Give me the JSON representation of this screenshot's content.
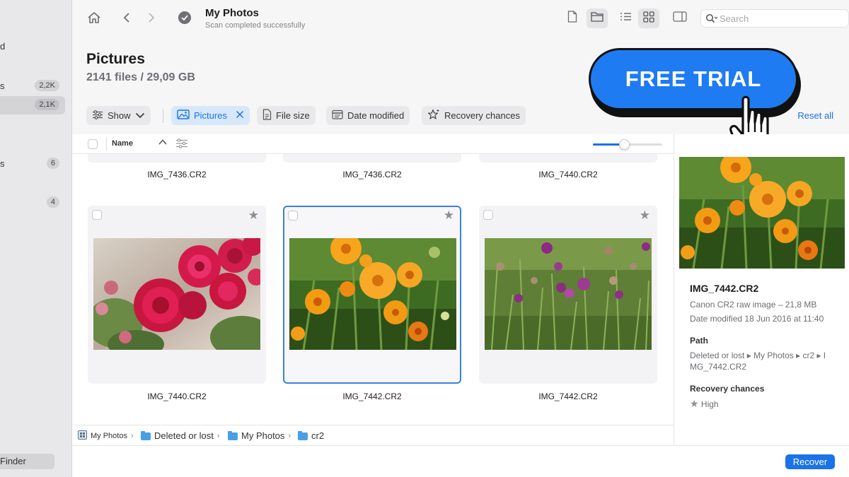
{
  "window": {
    "title": "My Photos",
    "subtitle": "Scan completed successfully",
    "search_placeholder": "Search"
  },
  "sidebar": {
    "fragments": [
      "d",
      "s",
      "s"
    ],
    "items": [
      {
        "badge": "2,2K"
      },
      {
        "badge": "2,1K",
        "selected": true
      },
      {
        "badge": "6"
      },
      {
        "badge": "4"
      }
    ],
    "finder_label": "Finder"
  },
  "header": {
    "title": "Pictures",
    "stats": "2141 files / 29,09 GB"
  },
  "filters": {
    "show_label": "Show",
    "active_filter": "Pictures",
    "file_size": "File size",
    "date_modified": "Date modified",
    "recovery_chances": "Recovery chances",
    "reset_all": "Reset all"
  },
  "promo": {
    "label": "FREE TRIAL"
  },
  "columns": {
    "name": "Name",
    "zoom_fraction": 0.45
  },
  "grid": {
    "top_row": [
      "IMG_7436.CR2",
      "IMG_7436.CR2",
      "IMG_7440.CR2"
    ],
    "items": [
      {
        "name": "IMG_7440.CR2",
        "image": "red roses",
        "selected": false
      },
      {
        "name": "IMG_7442.CR2",
        "image": "orange calendula flowers",
        "selected": true
      },
      {
        "name": "IMG_7442.CR2",
        "image": "purple thistle meadow",
        "selected": false
      }
    ]
  },
  "breadcrumb": [
    "My Photos",
    "Deleted or lost",
    "My Photos",
    "cr2"
  ],
  "details": {
    "name": "IMG_7442.CR2",
    "type_size": "Canon CR2 raw image – 21,8 MB",
    "date_label": "Date modified",
    "date_value": "18 Jun 2016 at 11:40",
    "path_heading": "Path",
    "path_line1": "Deleted or lost ▸ My Photos ▸ cr2 ▸ I",
    "path_line2": "MG_7442.CR2",
    "recovery_heading": "Recovery chances",
    "recovery_value": "High"
  },
  "footer": {
    "recover_label": "Recover"
  },
  "colors": {
    "accent": "#1a73e8",
    "promo": "#1f7bf2",
    "sidebar": "#e8e8ea",
    "selection_border": "#3b82d6"
  },
  "icons": [
    "home-icon",
    "back-icon",
    "forward-icon",
    "check-circle-icon",
    "file-icon",
    "folder-icon",
    "list-view-icon",
    "grid-view-icon",
    "sidebar-toggle-icon",
    "search-icon",
    "sliders-icon",
    "chevron-down-icon",
    "image-icon",
    "close-icon",
    "document-icon",
    "calendar-icon",
    "sparkle-star-icon",
    "star-icon",
    "hand-pointer-icon"
  ]
}
